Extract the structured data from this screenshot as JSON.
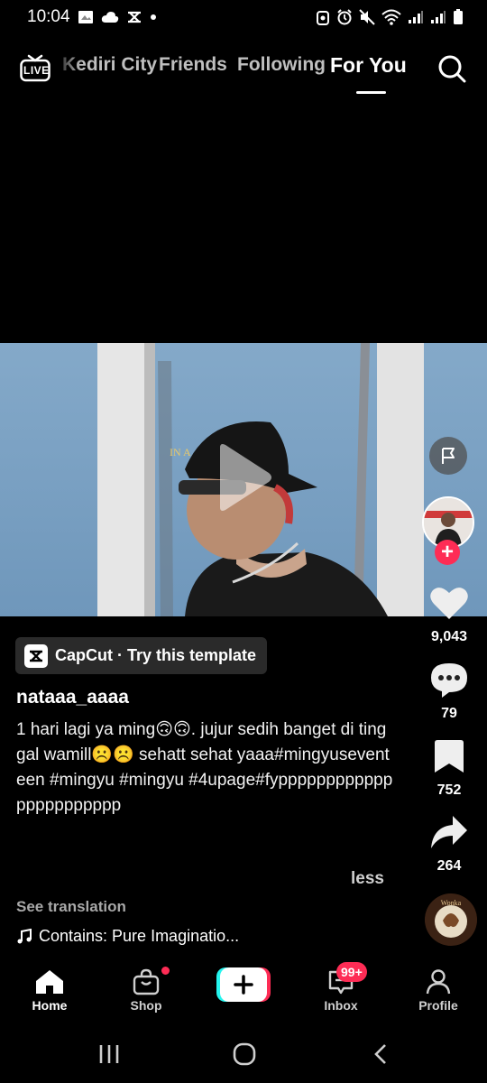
{
  "status_bar": {
    "time": "10:04"
  },
  "top_nav": {
    "live_label": "LIVE",
    "tabs": [
      {
        "label": "Kediri City"
      },
      {
        "label": "Friends"
      },
      {
        "label": "Following"
      },
      {
        "label": "For You"
      }
    ]
  },
  "video": {
    "caption_overlay": "IN A"
  },
  "actions": {
    "likes": "9,043",
    "comments": "79",
    "saves": "752",
    "shares": "264"
  },
  "post": {
    "template_label": "CapCut · Try this template",
    "username": "nataaa_aaaa",
    "caption": "1 hari lagi ya ming🙃🙃. jujur sedih banget di tinggal wamill☹️☹️ sehatt sehat yaaa#mingyuseventeen #mingyu #mingyu #4upage#fyppppppppppppppppppppppp",
    "less_label": "less",
    "see_translation": "See translation",
    "music": "Contains: Pure Imaginatio..."
  },
  "bottom_nav": {
    "home": "Home",
    "shop": "Shop",
    "inbox": "Inbox",
    "inbox_badge": "99+",
    "profile": "Profile"
  },
  "colors": {
    "accent": "#fe2c55",
    "background": "#000000",
    "tiktok_cyan": "#25f4ee"
  }
}
